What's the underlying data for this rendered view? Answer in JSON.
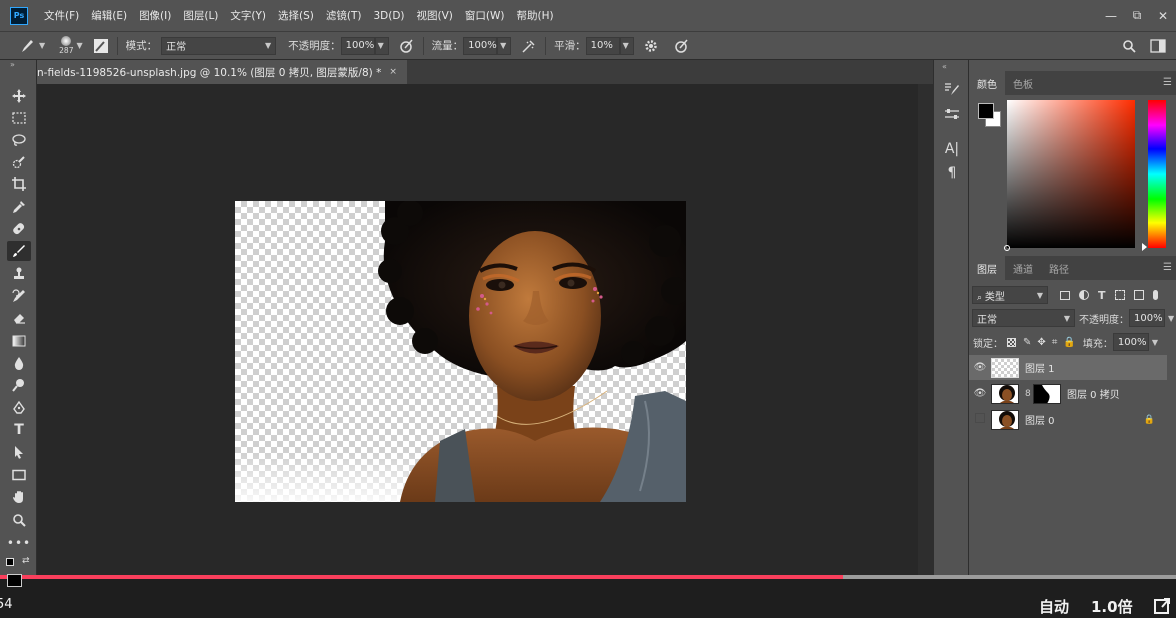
{
  "app": {
    "logo": "Ps"
  },
  "menu": [
    "文件(F)",
    "编辑(E)",
    "图像(I)",
    "图层(L)",
    "文字(Y)",
    "选择(S)",
    "滤镜(T)",
    "3D(D)",
    "视图(V)",
    "窗口(W)",
    "帮助(H)"
  ],
  "window_controls": {
    "minimize": "—",
    "restore": "⧉",
    "close": "✕"
  },
  "options": {
    "brush_size": "287",
    "mode_label": "模式：",
    "mode_value": "正常",
    "opacity_label": "不透明度：",
    "opacity_value": "100%",
    "flow_label": "流量：",
    "flow_value": "100%",
    "smoothing_label": "平滑：",
    "smoothing_value": "10%"
  },
  "document": {
    "tab_title": "n-fields-1198526-unsplash.jpg @ 10.1% (图层 0 拷贝, 图层蒙版/8) *",
    "close": "×"
  },
  "color_panel": {
    "tabs": [
      "颜色",
      "色板"
    ]
  },
  "layers_panel": {
    "tabs": [
      "图层",
      "通道",
      "路径"
    ],
    "filter_label": "类型",
    "blend_mode": "正常",
    "opacity_label": "不透明度：",
    "opacity_value": "100%",
    "lock_label": "锁定：",
    "fill_label": "填充：",
    "fill_value": "100%",
    "layers": [
      {
        "name": "图层 1",
        "visible": true,
        "selected": true,
        "locked": false
      },
      {
        "name": "图层 0 拷贝",
        "visible": true,
        "selected": false,
        "locked": false,
        "has_mask": true
      },
      {
        "name": "图层 0",
        "visible": false,
        "selected": false,
        "locked": true
      }
    ]
  },
  "video": {
    "progress": 0.717,
    "quality": "自动",
    "speed": "1.0倍",
    "time_fragment": "54"
  }
}
